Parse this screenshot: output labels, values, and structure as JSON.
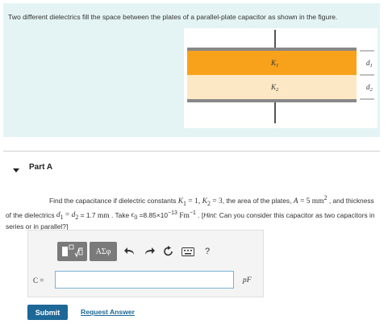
{
  "problem": {
    "intro": "Two different dielectrics fill the space between the plates of a parallel-plate capacitor as shown in the figure.",
    "figure": {
      "k1_label": "K",
      "k1_sub": "1",
      "k2_label": "K",
      "k2_sub": "2",
      "d1_label": "d",
      "d1_sub": "1",
      "d2_label": "d",
      "d2_sub": "2",
      "top_color": "#f7a21a",
      "bottom_color": "#fde8c6"
    }
  },
  "part": {
    "title": "Part A"
  },
  "question": {
    "t1": "Find the capacitance if dielectric constants ",
    "k1": "K",
    "k1_sub": "1",
    "k1_val": " = 1, ",
    "k2": "K",
    "k2_sub": "2",
    "k2_val": " = 3",
    "t2": ", the area of the plates, ",
    "a": "A",
    "a_val": " = 5 ",
    "mm": "mm",
    "mm_exp": "2",
    "t3": " , and thickness of the dielectrics ",
    "d1": "d",
    "d1_sub": "1",
    "eq1": " = ",
    "d2": "d",
    "d2_sub": "2",
    "t4": " = 1.7 ",
    "mm2": "mm",
    "t5": " . Take ",
    "eps": "ϵ",
    "eps_sub": "0",
    "t6": " =8.85×10",
    "exp": "−13",
    "t7": " Fm",
    "exp2": "−1",
    "t8": " . [",
    "hint_label": "Hint:",
    "hint": " Can you consider this capacitor as two capacitors in series or in parallel?]"
  },
  "answer": {
    "label": "C =",
    "value": "",
    "unit": "pF",
    "symbols_label": "ΑΣφ"
  },
  "actions": {
    "submit": "Submit",
    "request": "Request Answer"
  }
}
